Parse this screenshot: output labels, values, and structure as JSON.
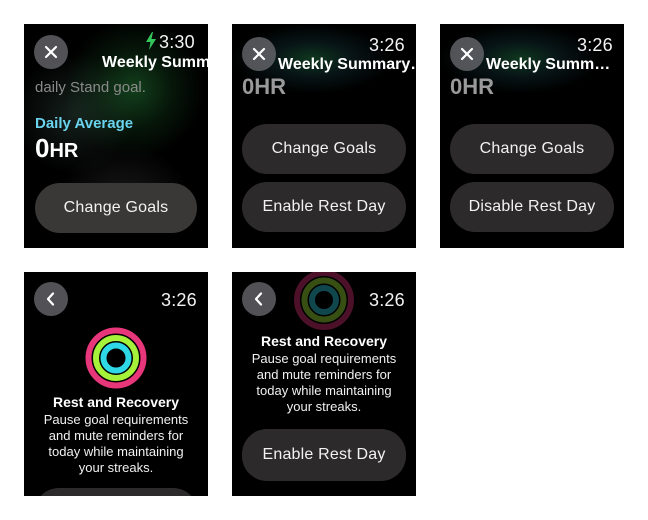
{
  "screens": [
    {
      "time": "3:30",
      "title": "Weekly Summ…",
      "partial_text": "daily Stand goal.",
      "label": "Daily Average",
      "value": "0",
      "unit": "HR",
      "button": "Change Goals"
    },
    {
      "time": "3:26",
      "title": "Weekly Summary…",
      "partial_value": "0HR",
      "buttons": [
        "Change Goals",
        "Enable Rest Day"
      ]
    },
    {
      "time": "3:26",
      "title": "Weekly Summ…",
      "partial_value": "0HR",
      "buttons": [
        "Change Goals",
        "Disable Rest Day"
      ]
    },
    {
      "time": "3:26",
      "heading": "Rest and Recovery",
      "body": [
        "Pause goal requirements",
        "and mute reminders for",
        "today while maintaining",
        "your streaks."
      ]
    },
    {
      "time": "3:26",
      "heading": "Rest and Recovery",
      "body": [
        "Pause goal requirements",
        "and mute reminders for",
        "today while maintaining",
        "your streaks."
      ],
      "button": "Enable Rest Day"
    }
  ],
  "colors": {
    "accent_cyan": "#6ad3ee",
    "charging_green": "#34c759",
    "move_ring": "#e8367a",
    "exercise_ring": "#a6f23a",
    "stand_ring": "#2fd8e6"
  }
}
